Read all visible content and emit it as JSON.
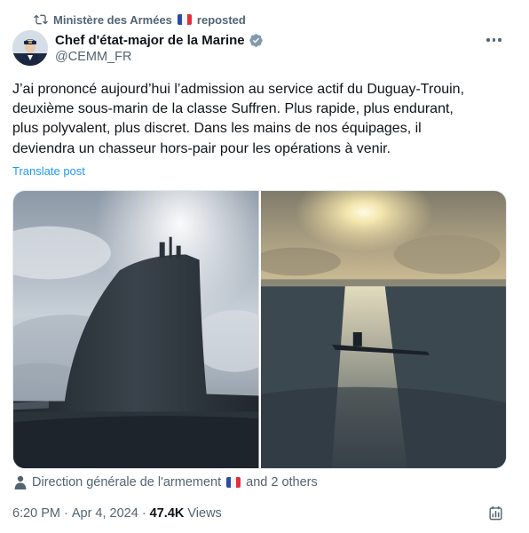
{
  "repost": {
    "account": "Ministère des Armées",
    "suffix": "reposted",
    "flag_colors": [
      "#002395",
      "#ffffff",
      "#ed2939"
    ]
  },
  "author": {
    "name": "Chef d'état-major de la Marine",
    "handle": "@CEMM_FR",
    "verified_color": "#829aab"
  },
  "tweet": {
    "text": "J’ai prononcé aujourd’hui l’admission au service actif du Duguay-Trouin,\ndeuxième sous-marin de la classe Suffren. Plus rapide, plus endurant,\nplus polyvalent, plus discret. Dans les mains de nos équipages, il\ndeviendra un chasseur hors-pair pour les opérations à venir.",
    "translate_label": "Translate post"
  },
  "media": {
    "photos": [
      {
        "icon": "submarine-sail-photo"
      },
      {
        "icon": "submarine-sunset-photo"
      }
    ]
  },
  "tags": {
    "account": "Direction générale de l'armement",
    "others": "and 2 others",
    "icon": "person-icon"
  },
  "meta": {
    "time": "6:20 PM",
    "separator": "·",
    "date": "Apr 4, 2024",
    "separator2": "·",
    "views_count": "47.4K",
    "views_label": "Views"
  },
  "colors": {
    "text": "#0f1419",
    "secondary": "#536471",
    "link": "#1d9bf0"
  }
}
